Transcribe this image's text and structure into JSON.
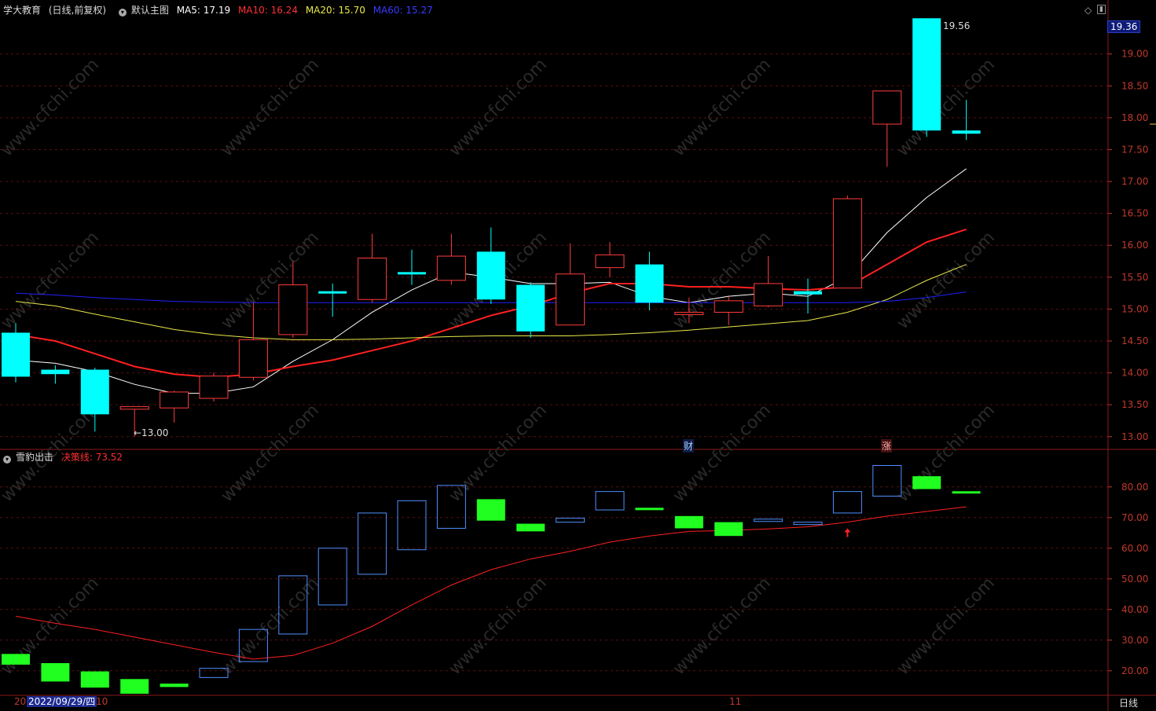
{
  "header": {
    "stock_name": "学大教育",
    "period_label": "(日线,前复权)",
    "theme_label": "默认主图",
    "ma5": "MA5: 17.19",
    "ma10": "MA10: 16.24",
    "ma20": "MA20: 15.70",
    "ma60": "MA60: 15.27"
  },
  "sub_header": {
    "indicator_name": "雪豹出击",
    "line_label": "决策线: 73.52"
  },
  "axis": {
    "date_cursor": "2022/09/29/四",
    "date_prefix": "20",
    "month_10": "10",
    "month_11": "11",
    "period_button": "日线",
    "current_price": "19.36",
    "high_label": "19.56",
    "low_label": "←13.00",
    "event_cai": "财",
    "event_zhang": "涨"
  },
  "watermark": "www.cfchi.com",
  "colors": {
    "up": "#ff3b3b",
    "down": "#00ffff",
    "ma5": "#ffffff",
    "ma10": "#ff2020",
    "ma20": "#e8e84a",
    "ma60": "#2020ff",
    "sub_up": "#4f8fff",
    "sub_down": "#20ff20",
    "decision": "#ff2020"
  },
  "chart_data": [
    {
      "type": "candlestick",
      "title": "学大教育 (日线,前复权)",
      "ylim": [
        12.8,
        19.6
      ],
      "yticks": [
        13.0,
        13.5,
        14.0,
        14.5,
        15.0,
        15.5,
        16.0,
        16.5,
        17.0,
        17.5,
        18.0,
        18.5,
        19.0
      ],
      "candles": [
        {
          "o": 14.63,
          "h": 14.78,
          "l": 13.85,
          "c": 13.94
        },
        {
          "o": 14.05,
          "h": 14.12,
          "l": 13.83,
          "c": 13.98
        },
        {
          "o": 14.05,
          "h": 14.08,
          "l": 13.08,
          "c": 13.35
        },
        {
          "o": 13.43,
          "h": 13.47,
          "l": 13.0,
          "c": 13.47
        },
        {
          "o": 13.45,
          "h": 13.72,
          "l": 13.22,
          "c": 13.7
        },
        {
          "o": 13.6,
          "h": 14.0,
          "l": 13.55,
          "c": 13.95
        },
        {
          "o": 13.93,
          "h": 15.1,
          "l": 13.88,
          "c": 14.52
        },
        {
          "o": 14.6,
          "h": 15.75,
          "l": 14.55,
          "c": 15.38
        },
        {
          "o": 15.28,
          "h": 15.4,
          "l": 14.88,
          "c": 15.25
        },
        {
          "o": 15.15,
          "h": 16.18,
          "l": 15.1,
          "c": 15.8
        },
        {
          "o": 15.58,
          "h": 15.93,
          "l": 15.38,
          "c": 15.55
        },
        {
          "o": 15.45,
          "h": 16.18,
          "l": 15.38,
          "c": 15.83
        },
        {
          "o": 15.9,
          "h": 16.28,
          "l": 15.08,
          "c": 15.15
        },
        {
          "o": 15.38,
          "h": 15.42,
          "l": 14.55,
          "c": 14.65
        },
        {
          "o": 14.75,
          "h": 16.03,
          "l": 14.75,
          "c": 15.55
        },
        {
          "o": 15.65,
          "h": 16.05,
          "l": 15.5,
          "c": 15.85
        },
        {
          "o": 15.7,
          "h": 15.9,
          "l": 14.98,
          "c": 15.1
        },
        {
          "o": 14.95,
          "h": 15.18,
          "l": 14.78,
          "c": 14.95
        },
        {
          "o": 14.95,
          "h": 15.2,
          "l": 14.75,
          "c": 15.13
        },
        {
          "o": 15.05,
          "h": 15.83,
          "l": 15.03,
          "c": 15.4
        },
        {
          "o": 15.28,
          "h": 15.48,
          "l": 14.93,
          "c": 15.23
        },
        {
          "o": 15.33,
          "h": 16.78,
          "l": 15.33,
          "c": 16.73
        },
        {
          "o": 17.9,
          "h": 18.42,
          "l": 17.23,
          "c": 18.42
        },
        {
          "o": 19.56,
          "h": 19.56,
          "l": 17.7,
          "c": 17.8
        },
        {
          "o": 17.8,
          "h": 18.28,
          "l": 17.65,
          "c": 17.75
        }
      ],
      "series": [
        {
          "name": "MA5",
          "values": [
            14.2,
            14.15,
            14.02,
            13.82,
            13.68,
            13.68,
            13.78,
            14.18,
            14.52,
            14.95,
            15.3,
            15.58,
            15.5,
            15.4,
            15.4,
            15.42,
            15.2,
            15.1,
            15.2,
            15.25,
            15.2,
            15.5,
            16.2,
            16.75,
            17.2
          ]
        },
        {
          "name": "MA10",
          "values": [
            14.6,
            14.5,
            14.3,
            14.1,
            13.98,
            13.93,
            13.98,
            14.1,
            14.2,
            14.35,
            14.5,
            14.7,
            14.9,
            15.05,
            15.25,
            15.4,
            15.4,
            15.35,
            15.35,
            15.32,
            15.3,
            15.35,
            15.7,
            16.05,
            16.25
          ]
        },
        {
          "name": "MA20",
          "values": [
            15.12,
            15.05,
            14.92,
            14.8,
            14.68,
            14.6,
            14.55,
            14.52,
            14.52,
            14.53,
            14.55,
            14.57,
            14.58,
            14.58,
            14.58,
            14.6,
            14.63,
            14.67,
            14.72,
            14.77,
            14.82,
            14.95,
            15.15,
            15.45,
            15.7
          ]
        },
        {
          "name": "MA60",
          "values": [
            15.25,
            15.22,
            15.18,
            15.15,
            15.12,
            15.11,
            15.1,
            15.1,
            15.1,
            15.1,
            15.1,
            15.1,
            15.1,
            15.1,
            15.1,
            15.1,
            15.1,
            15.1,
            15.1,
            15.1,
            15.1,
            15.1,
            15.12,
            15.18,
            15.27
          ]
        }
      ]
    },
    {
      "type": "bar",
      "title": "雪豹出击",
      "ylim": [
        12,
        92
      ],
      "yticks": [
        20,
        30,
        40,
        50,
        60,
        70,
        80
      ],
      "boxes": [
        {
          "o": 25.5,
          "c": 22.0
        },
        {
          "o": 22.5,
          "c": 16.5
        },
        {
          "o": 19.8,
          "c": 14.5
        },
        {
          "o": 17.3,
          "c": 12.5
        },
        {
          "o": 15.8,
          "c": 14.7
        },
        {
          "o": 17.8,
          "c": 20.8
        },
        {
          "o": 23.0,
          "c": 33.5
        },
        {
          "o": 32.0,
          "c": 51.0
        },
        {
          "o": 41.5,
          "c": 60.0
        },
        {
          "o": 51.5,
          "c": 71.5
        },
        {
          "o": 59.5,
          "c": 75.5
        },
        {
          "o": 66.5,
          "c": 80.5
        },
        {
          "o": 76.0,
          "c": 69.0
        },
        {
          "o": 68.0,
          "c": 65.5
        },
        {
          "o": 68.5,
          "c": 69.8
        },
        {
          "o": 72.5,
          "c": 78.5
        },
        {
          "o": 73.2,
          "c": 72.5
        },
        {
          "o": 70.5,
          "c": 66.5
        },
        {
          "o": 68.5,
          "c": 64.0
        },
        {
          "o": 68.8,
          "c": 69.5
        },
        {
          "o": 68.0,
          "c": 68.5
        },
        {
          "o": 71.5,
          "c": 78.5
        },
        {
          "o": 77.0,
          "c": 87.0
        },
        {
          "o": 83.5,
          "c": 79.3
        },
        {
          "o": 78.6,
          "c": 78.1
        }
      ],
      "series": [
        {
          "name": "决策线",
          "values": [
            37.8,
            35.5,
            33.5,
            31.0,
            28.5,
            26.0,
            23.8,
            25.0,
            29.0,
            34.5,
            41.5,
            48.0,
            53.0,
            56.5,
            59.0,
            62.0,
            64.0,
            65.5,
            65.8,
            66.3,
            67.0,
            68.5,
            70.5,
            72.0,
            73.5
          ]
        }
      ]
    }
  ]
}
